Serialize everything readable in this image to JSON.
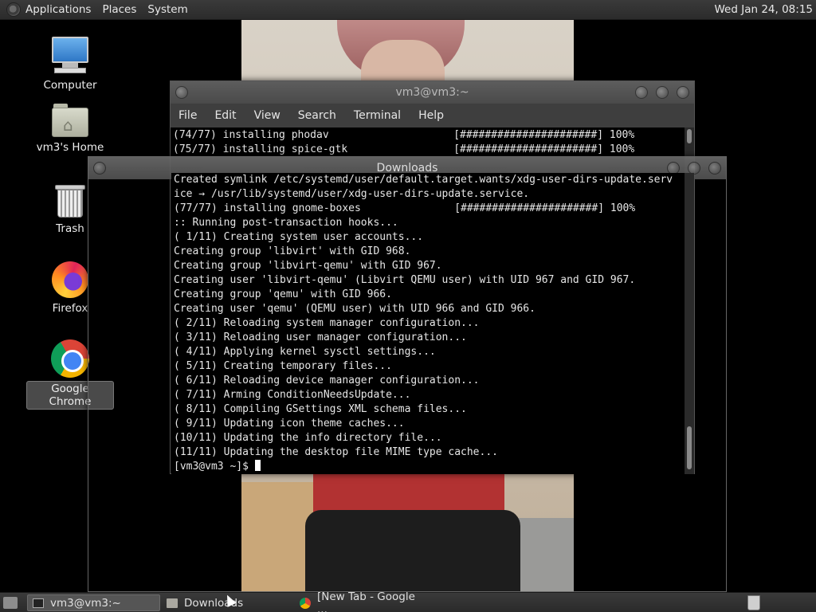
{
  "top_panel": {
    "menus": [
      "Applications",
      "Places",
      "System"
    ],
    "clock": "Wed Jan 24, 08:15"
  },
  "desktop_icons": [
    {
      "label": "Computer",
      "icon": "computer-icon"
    },
    {
      "label": "vm3's Home",
      "icon": "home-folder-icon"
    },
    {
      "label": "Trash",
      "icon": "trash-icon"
    },
    {
      "label": "Firefox",
      "icon": "firefox-icon"
    },
    {
      "label": "Google Chrome",
      "icon": "chrome-icon",
      "selected": true
    }
  ],
  "back_terminal": {
    "title": "vm3@vm3:~",
    "menu": [
      "File",
      "Edit",
      "View",
      "Search",
      "Terminal",
      "Help"
    ],
    "lines": [
      "(74/77) installing phodav                    [######################] 100%",
      "(75/77) installing spice-gtk                 [######################] 100%"
    ]
  },
  "front_terminal": {
    "title": "Downloads",
    "lines": [
      "Created symlink /etc/systemd/user/default.target.wants/xdg-user-dirs-update.serv",
      "ice → /usr/lib/systemd/user/xdg-user-dirs-update.service.",
      "(77/77) installing gnome-boxes               [######################] 100%",
      ":: Running post-transaction hooks...",
      "( 1/11) Creating system user accounts...",
      "Creating group 'libvirt' with GID 968.",
      "Creating group 'libvirt-qemu' with GID 967.",
      "Creating user 'libvirt-qemu' (Libvirt QEMU user) with UID 967 and GID 967.",
      "Creating group 'qemu' with GID 966.",
      "Creating user 'qemu' (QEMU user) with UID 966 and GID 966.",
      "( 2/11) Reloading system manager configuration...",
      "( 3/11) Reloading user manager configuration...",
      "( 4/11) Applying kernel sysctl settings...",
      "( 5/11) Creating temporary files...",
      "( 6/11) Reloading device manager configuration...",
      "( 7/11) Arming ConditionNeedsUpdate...",
      "( 8/11) Compiling GSettings XML schema files...",
      "( 9/11) Updating icon theme caches...",
      "(10/11) Updating the info directory file...",
      "(11/11) Updating the desktop file MIME type cache..."
    ],
    "prompt": "[vm3@vm3 ~]$ "
  },
  "taskbar": {
    "tasks": [
      {
        "label": "vm3@vm3:~",
        "icon": "terminal-icon",
        "active": true
      },
      {
        "label": "Downloads",
        "icon": "folder-icon",
        "active": false
      },
      {
        "label": "[New Tab - Google ...",
        "icon": "chrome-icon",
        "active": false
      }
    ]
  },
  "colors": {
    "panel": "#2f2f2f",
    "terminal_bg": "#000000",
    "terminal_fg": "#e6e6e6"
  }
}
